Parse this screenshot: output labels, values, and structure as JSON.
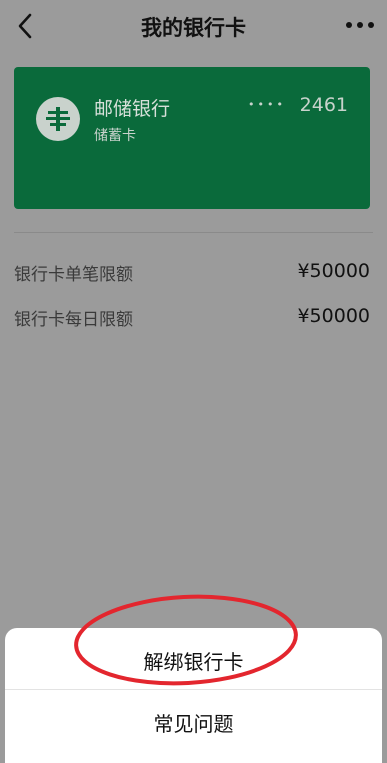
{
  "nav": {
    "title": "我的银行卡"
  },
  "card": {
    "bank_name": "邮储银行",
    "card_type": "储蓄卡",
    "masked": "••••",
    "last4": "2461",
    "color": "#0a6a3b"
  },
  "limits": [
    {
      "label": "银行卡单笔限额",
      "value": "¥50000"
    },
    {
      "label": "银行卡每日限额",
      "value": "¥50000"
    }
  ],
  "sheet": {
    "unbind_label": "解绑银行卡",
    "faq_label": "常见问题"
  },
  "annotation_color": "#e3262e"
}
